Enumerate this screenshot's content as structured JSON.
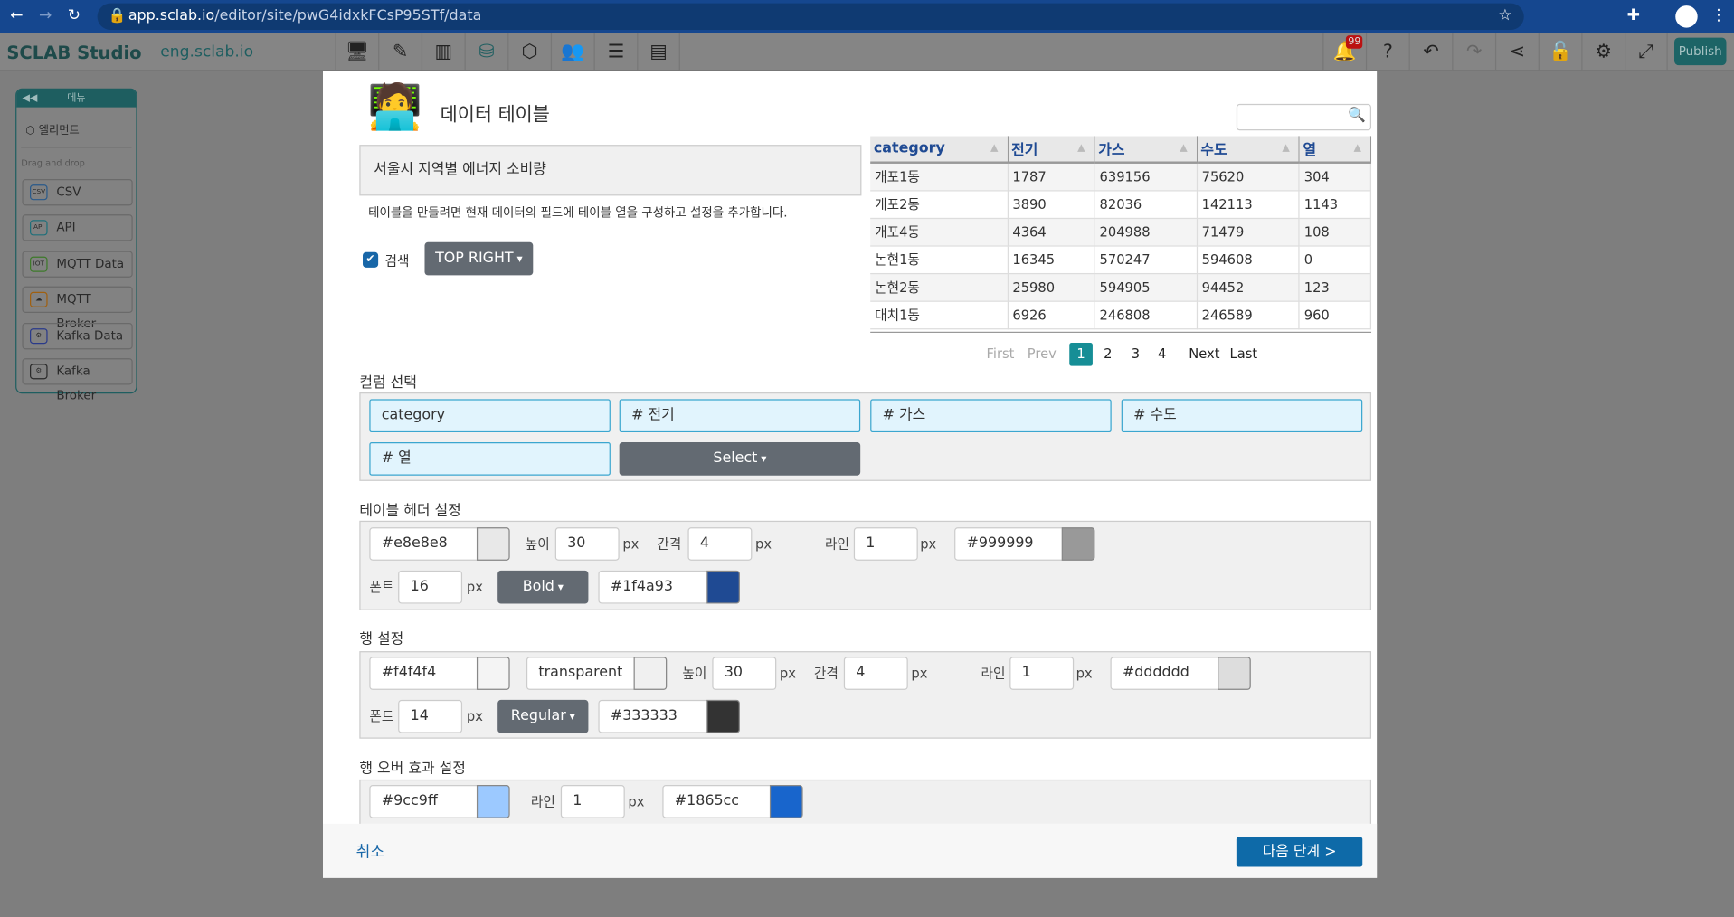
{
  "browser": {
    "url_host": "app.sclab.io",
    "url_path": "/editor/site/pwG4idxkFCsP95STf/data"
  },
  "app": {
    "logo": "SCLAB Studio",
    "site": "eng.sclab.io",
    "notification_count": "99",
    "publish": "Publish",
    "toolbar_icons": [
      "desktop-edit-icon",
      "mobile-edit-icon",
      "map-icon",
      "database-icon",
      "code-icon",
      "users-icon",
      "list-icon",
      "card-icon"
    ]
  },
  "sidebar": {
    "title": "메뉴",
    "element": "엘리먼트",
    "drag_label": "Drag and drop",
    "items": [
      {
        "label": "CSV",
        "icon": "CSV",
        "color": "#2a5a8a"
      },
      {
        "label": "API",
        "icon": "API",
        "color": "#1e6f7a"
      },
      {
        "label": "MQTT Data",
        "icon": "IOT",
        "color": "#3d7a2a"
      },
      {
        "label": "MQTT Broker",
        "icon": "☁",
        "color": "#a06010"
      },
      {
        "label": "Kafka Data",
        "icon": "⚙",
        "color": "#2a3a8a"
      },
      {
        "label": "Kafka Broker",
        "icon": "⚙",
        "color": "#2a2a2a"
      }
    ]
  },
  "modal": {
    "title": "데이터 테이블",
    "dataset": "서울시 지역별 에너지 소비량",
    "description": "테이블을 만들려면 현재 데이터의 필드에 테이블 열을 구성하고 설정을 추가합니다.",
    "search_checkbox": {
      "label": "검색",
      "checked": true
    },
    "search_position": "TOP RIGHT",
    "preview": {
      "columns": [
        "category",
        "전기",
        "가스",
        "수도",
        "열"
      ],
      "rows": [
        [
          "개포1동",
          "1787",
          "639156",
          "75620",
          "304"
        ],
        [
          "개포2동",
          "3890",
          "82036",
          "142113",
          "1143"
        ],
        [
          "개포4동",
          "4364",
          "204988",
          "71479",
          "108"
        ],
        [
          "논현1동",
          "16345",
          "570247",
          "594608",
          "0"
        ],
        [
          "논현2동",
          "25980",
          "594905",
          "94452",
          "123"
        ],
        [
          "대치1동",
          "6926",
          "246808",
          "246589",
          "960"
        ]
      ],
      "pagination": {
        "first": "First",
        "prev": "Prev",
        "pages": [
          "1",
          "2",
          "3",
          "4"
        ],
        "current": "1",
        "next": "Next",
        "last": "Last"
      }
    },
    "column_select": {
      "label": "컬럼 선택",
      "chips": [
        "category",
        "# 전기",
        "# 가스",
        "# 수도",
        "# 열"
      ],
      "select": "Select"
    },
    "header_settings": {
      "label": "테이블 헤더 설정",
      "bg": "#e8e8e8",
      "height_label": "높이",
      "height": "30",
      "gap_label": "간격",
      "gap": "4",
      "line_label": "라인",
      "line": "1",
      "line_color": "#999999",
      "font_label": "폰트",
      "font": "16",
      "weight": "Bold",
      "font_color": "#1f4a93",
      "px": "px"
    },
    "row_settings": {
      "label": "행 설정",
      "bg": "#f4f4f4",
      "bg2": "transparent",
      "height_label": "높이",
      "height": "30",
      "gap_label": "간격",
      "gap": "4",
      "line_label": "라인",
      "line": "1",
      "line_color": "#dddddd",
      "font_label": "폰트",
      "font": "14",
      "weight": "Regular",
      "font_color": "#333333",
      "px": "px"
    },
    "hover_settings": {
      "label": "행 오버 효과 설정",
      "bg": "#9cc9ff",
      "line_label": "라인",
      "line": "1",
      "line_color": "#1865cc",
      "px": "px"
    },
    "cancel": "취소",
    "next": "다음 단계 >"
  }
}
